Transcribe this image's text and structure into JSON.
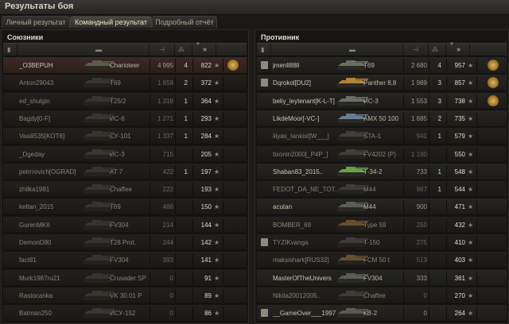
{
  "window": {
    "title": "Результаты боя"
  },
  "tabs": [
    {
      "label": "Личный результат",
      "active": false
    },
    {
      "label": "Командный результат",
      "active": true
    },
    {
      "label": "Подробный отчёт",
      "active": false
    }
  ],
  "allies": {
    "title": "Союзники",
    "rows": [
      {
        "player": "_O3BEPUH",
        "vehicle": "Charioteer",
        "damage": "4 995",
        "kills": "4",
        "xp": "822",
        "self": true,
        "alive": true,
        "medal": true,
        "tank_color": "#5f5b4a"
      },
      {
        "player": "Anton29043",
        "vehicle": "T69",
        "damage": "1 858",
        "kills": "2",
        "xp": "372",
        "alive": false,
        "tank_color": "#4a4d44"
      },
      {
        "player": "ed_shulgin",
        "vehicle": "T25/2",
        "damage": "1 316",
        "kills": "1",
        "xp": "364",
        "alive": false,
        "tank_color": "#4b4a42"
      },
      {
        "player": "Bagdy[0-F]",
        "vehicle": "ИС-6",
        "damage": "1 271",
        "kills": "1",
        "xp": "293",
        "alive": false,
        "tank_color": "#4d5048"
      },
      {
        "player": "Vasili535[KOT6]",
        "vehicle": "СУ-101",
        "damage": "1 337",
        "kills": "1",
        "xp": "284",
        "alive": false,
        "tank_color": "#4a4b42"
      },
      {
        "player": "_Dgeday",
        "vehicle": "ИС-3",
        "damage": "715",
        "kills": "",
        "xp": "205",
        "alive": false,
        "tank_color": "#4c4e47"
      },
      {
        "player": "petrrrovich[OGRAD]",
        "vehicle": "AT 7",
        "damage": "422",
        "kills": "1",
        "xp": "197",
        "alive": false,
        "tank_color": "#494a41"
      },
      {
        "player": "zhilka1981",
        "vehicle": "Chaffee",
        "damage": "222",
        "kills": "",
        "xp": "193",
        "alive": false,
        "tank_color": "#4b4b43"
      },
      {
        "player": "keltan_2015",
        "vehicle": "T69",
        "damage": "486",
        "kills": "",
        "xp": "150",
        "alive": false,
        "tank_color": "#4a4d44"
      },
      {
        "player": "GurenMKII",
        "vehicle": "FV304",
        "damage": "214",
        "kills": "",
        "xp": "144",
        "alive": false,
        "tank_color": "#484941"
      },
      {
        "player": "DemonD80",
        "vehicle": "T28 Prot.",
        "damage": "244",
        "kills": "",
        "xp": "142",
        "alive": false,
        "tank_color": "#4a4b44"
      },
      {
        "player": "fact81",
        "vehicle": "FV304",
        "damage": "393",
        "kills": "",
        "xp": "141",
        "alive": false,
        "tank_color": "#484941"
      },
      {
        "player": "Murk1987ru21",
        "vehicle": "Crusader SP",
        "damage": "0",
        "kills": "",
        "xp": "91",
        "alive": false,
        "tank_color": "#4a4a41"
      },
      {
        "player": "Rastocanka",
        "vehicle": "VK 30.01 P",
        "damage": "0",
        "kills": "",
        "xp": "89",
        "alive": false,
        "tank_color": "#4b4c45"
      },
      {
        "player": "Batman250",
        "vehicle": "ИСУ-152",
        "damage": "0",
        "kills": "",
        "xp": "86",
        "alive": false,
        "tank_color": "#4c4d46"
      }
    ]
  },
  "enemies": {
    "title": "Противник",
    "rows": [
      {
        "player": "jmenll88ll",
        "vehicle": "T69",
        "damage": "2 680",
        "kills": "4",
        "xp": "957",
        "alive": true,
        "medal": true,
        "platoon": true,
        "tank_color": "#6a7060"
      },
      {
        "player": "Dqrokol[DU2]",
        "vehicle": "Panther 8,8",
        "damage": "1 989",
        "kills": "3",
        "xp": "857",
        "alive": true,
        "medal": true,
        "platoon": true,
        "tank_color": "#b2843c"
      },
      {
        "player": "beliy_leytenant[K-L-T]",
        "vehicle": "ИС-3",
        "damage": "1 553",
        "kills": "3",
        "xp": "738",
        "alive": true,
        "medal": true,
        "tank_color": "#6b6e66"
      },
      {
        "player": "LikdeMoor[-VC-]",
        "vehicle": "AMX 50 100",
        "damage": "1 685",
        "kills": "2",
        "xp": "735",
        "alive": true,
        "tank_color": "#6a7c94"
      },
      {
        "player": "iliyas_tankist[W___]",
        "vehicle": "STA-1",
        "damage": "941",
        "kills": "1",
        "xp": "579",
        "alive": false,
        "tank_color": "#5b5e55"
      },
      {
        "player": "tixonin2000[_P4P_]",
        "vehicle": "FV4202 (P)",
        "damage": "1 190",
        "kills": "",
        "xp": "550",
        "alive": false,
        "tank_color": "#5c5a50"
      },
      {
        "player": "Shaban83_2015..",
        "vehicle": "Т-34-2",
        "damage": "733",
        "kills": "1",
        "xp": "548",
        "alive": true,
        "tank_color": "#6aa049"
      },
      {
        "player": "FEDOT_DA_NE_TOT...",
        "vehicle": "M44",
        "damage": "987",
        "kills": "1",
        "xp": "544",
        "alive": false,
        "tank_color": "#55564d"
      },
      {
        "player": "acutan",
        "vehicle": "M44",
        "damage": "900",
        "kills": "",
        "xp": "471",
        "alive": true,
        "tank_color": "#5c5e54"
      },
      {
        "player": "BOMBER_69",
        "vehicle": "Type 59",
        "damage": "250",
        "kills": "",
        "xp": "432",
        "alive": false,
        "tank_color": "#a07a3c"
      },
      {
        "player": "TYZIKvanga",
        "vehicle": "T-150",
        "damage": "275",
        "kills": "",
        "xp": "410",
        "alive": false,
        "platoon": true,
        "tank_color": "#585a52"
      },
      {
        "player": "maksishark[RUS32]",
        "vehicle": "FCM 50 t",
        "damage": "513",
        "kills": "",
        "xp": "403",
        "alive": false,
        "tank_color": "#9c7a3e"
      },
      {
        "player": "MasterOfTheUnivers",
        "vehicle": "FV304",
        "damage": "333",
        "kills": "",
        "xp": "361",
        "alive": true,
        "tank_color": "#5b5d54"
      },
      {
        "player": "Nikita20012005..",
        "vehicle": "Chaffee",
        "damage": "0",
        "kills": "",
        "xp": "270",
        "alive": false,
        "tank_color": "#55574f"
      },
      {
        "player": "__GameOver___1997",
        "vehicle": "КВ-2",
        "damage": "0",
        "kills": "",
        "xp": "264",
        "alive": true,
        "platoon": true,
        "tank_color": "#5a5c54"
      }
    ]
  },
  "icons": {
    "col_platoon": "squad-icon",
    "col_vehicle": "tank-icon",
    "col_damage": "damage-icon",
    "col_kills": "kills-icon",
    "col_xp": "star-icon",
    "row_xp": "★",
    "sort": "▼"
  }
}
